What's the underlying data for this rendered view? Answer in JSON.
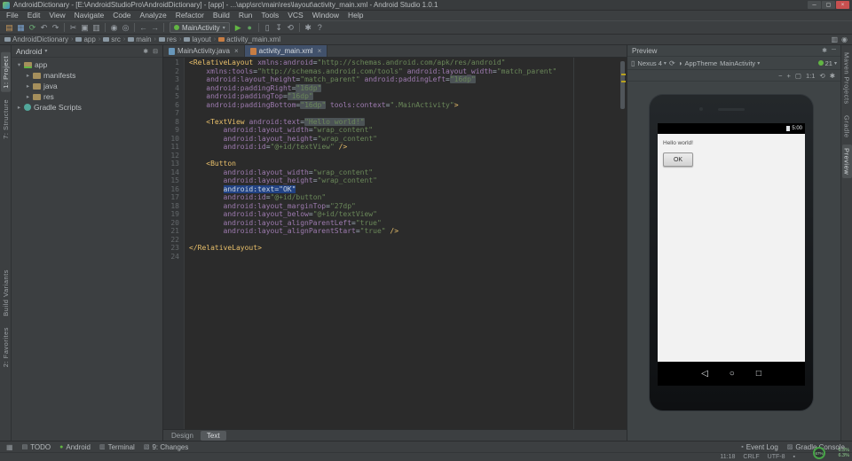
{
  "window": {
    "title": "AndroidDictionary - [E:\\AndroidStudioPro\\AndroidDictionary] - [app] - ...\\app\\src\\main\\res\\layout\\activity_main.xml - Android Studio 1.0.1",
    "controls": {
      "minimize": "─",
      "maximize": "▢",
      "close": "×"
    }
  },
  "menubar": {
    "items": [
      "File",
      "Edit",
      "View",
      "Navigate",
      "Code",
      "Analyze",
      "Refactor",
      "Build",
      "Run",
      "Tools",
      "VCS",
      "Window",
      "Help"
    ]
  },
  "toolbar": {
    "run_config": "MainActivity",
    "items": [
      {
        "name": "open",
        "glyph": "▤",
        "color": "#c9985a"
      },
      {
        "name": "save-all",
        "glyph": "▦",
        "color": "#7ba3d0"
      },
      {
        "name": "sync",
        "glyph": "⟳",
        "color": "#6aab73"
      },
      {
        "name": "undo",
        "glyph": "↶",
        "color": "#9aa0a6"
      },
      {
        "name": "redo",
        "glyph": "↷",
        "color": "#9aa0a6"
      },
      {
        "sep": true
      },
      {
        "name": "cut",
        "glyph": "✂",
        "color": "#9aa0a6"
      },
      {
        "name": "copy",
        "glyph": "▣",
        "color": "#9aa0a6"
      },
      {
        "name": "paste",
        "glyph": "▥",
        "color": "#9aa0a6"
      },
      {
        "sep": true
      },
      {
        "name": "find",
        "glyph": "◉",
        "color": "#9aa0a6"
      },
      {
        "name": "replace",
        "glyph": "◎",
        "color": "#9aa0a6"
      },
      {
        "sep": true
      },
      {
        "name": "back",
        "glyph": "←",
        "color": "#8a9096"
      },
      {
        "name": "forward",
        "glyph": "→",
        "color": "#8a9096"
      },
      {
        "sep": true
      },
      {
        "combo": true
      },
      {
        "name": "run",
        "glyph": "▶",
        "color": "#62b543"
      },
      {
        "name": "debug",
        "glyph": "●",
        "color": "#5f9e5f"
      },
      {
        "sep": true
      },
      {
        "name": "avd-manager",
        "glyph": "▯",
        "color": "#9aa0a6"
      },
      {
        "name": "sdk-manager",
        "glyph": "↧",
        "color": "#9aa0a6"
      },
      {
        "name": "gradle-sync",
        "glyph": "⟲",
        "color": "#9aa0a6"
      },
      {
        "sep": true
      },
      {
        "name": "settings",
        "glyph": "✱",
        "color": "#9aa0a6"
      },
      {
        "name": "help",
        "glyph": "?",
        "color": "#9aa0a6"
      }
    ]
  },
  "breadcrumbs": {
    "items": [
      "AndroidDictionary",
      "app",
      "src",
      "main",
      "res",
      "layout",
      "activity_main.xml"
    ],
    "right_icons": [
      {
        "name": "android-monitor",
        "glyph": "▥"
      },
      {
        "name": "search-everywhere",
        "glyph": "◉"
      }
    ]
  },
  "left_stripe": {
    "items": [
      {
        "label": "1: Project",
        "active": true
      },
      {
        "label": "7: Structure"
      },
      {
        "label": "Build Variants",
        "gap": true
      },
      {
        "label": "2: Favorites"
      }
    ]
  },
  "right_stripe": {
    "items": [
      {
        "label": "Maven Projects"
      },
      {
        "label": "Gradle"
      },
      {
        "label": "Preview",
        "active": true
      }
    ]
  },
  "project": {
    "header": "Android",
    "tree": [
      {
        "label": "app",
        "depth": 0,
        "expanded": true,
        "icon": "folder-app"
      },
      {
        "label": "manifests",
        "depth": 1,
        "expanded": false,
        "icon": "folder"
      },
      {
        "label": "java",
        "depth": 1,
        "expanded": false,
        "icon": "folder"
      },
      {
        "label": "res",
        "depth": 1,
        "expanded": false,
        "icon": "folder"
      },
      {
        "label": "Gradle Scripts",
        "depth": 0,
        "expanded": false,
        "icon": "gradle"
      }
    ]
  },
  "editor": {
    "tabs": [
      {
        "label": "MainActivity.java",
        "active": false
      },
      {
        "label": "activity_main.xml",
        "active": true
      }
    ],
    "bottom_tabs": [
      {
        "label": "Design",
        "active": false
      },
      {
        "label": "Text",
        "active": true
      }
    ],
    "code": [
      [
        [
          "tg",
          "<RelativeLayout"
        ],
        [
          "pl",
          " "
        ],
        [
          "at",
          "xmlns:android"
        ],
        [
          "pl",
          "="
        ],
        [
          "vl",
          "\"http://schemas.android.com/apk/res/android\""
        ]
      ],
      [
        [
          "pl",
          "    "
        ],
        [
          "at",
          "xmlns:tools"
        ],
        [
          "pl",
          "="
        ],
        [
          "vl",
          "\"http://schemas.android.com/tools\""
        ],
        [
          "pl",
          " "
        ],
        [
          "at",
          "android:layout_width"
        ],
        [
          "pl",
          "="
        ],
        [
          "vl",
          "\"match_parent\""
        ]
      ],
      [
        [
          "pl",
          "    "
        ],
        [
          "at",
          "android:layout_height"
        ],
        [
          "pl",
          "="
        ],
        [
          "vl",
          "\"match_parent\""
        ],
        [
          "pl",
          " "
        ],
        [
          "at",
          "android:paddingLeft"
        ],
        [
          "pl",
          "="
        ],
        [
          "vl",
          "\"16dp\"",
          "box"
        ]
      ],
      [
        [
          "pl",
          "    "
        ],
        [
          "at",
          "android:paddingRight"
        ],
        [
          "pl",
          "="
        ],
        [
          "vl",
          "\"16dp\"",
          "box"
        ]
      ],
      [
        [
          "pl",
          "    "
        ],
        [
          "at",
          "android:paddingTop"
        ],
        [
          "pl",
          "="
        ],
        [
          "vl",
          "\"16dp\"",
          "box"
        ]
      ],
      [
        [
          "pl",
          "    "
        ],
        [
          "at",
          "android:paddingBottom"
        ],
        [
          "pl",
          "="
        ],
        [
          "vl",
          "\"16dp\"",
          "box"
        ],
        [
          "pl",
          " "
        ],
        [
          "at",
          "tools:context"
        ],
        [
          "pl",
          "="
        ],
        [
          "vl",
          "\".MainActivity\""
        ],
        [
          "tg",
          ">"
        ]
      ],
      [],
      [
        [
          "pl",
          "    "
        ],
        [
          "tg",
          "<TextView"
        ],
        [
          "pl",
          " "
        ],
        [
          "at",
          "android:text"
        ],
        [
          "pl",
          "="
        ],
        [
          "vl",
          "\"Hello world!\"",
          "box"
        ]
      ],
      [
        [
          "pl",
          "        "
        ],
        [
          "at",
          "android:layout_width"
        ],
        [
          "pl",
          "="
        ],
        [
          "vl",
          "\"wrap_content\""
        ]
      ],
      [
        [
          "pl",
          "        "
        ],
        [
          "at",
          "android:layout_height"
        ],
        [
          "pl",
          "="
        ],
        [
          "vl",
          "\"wrap_content\""
        ]
      ],
      [
        [
          "pl",
          "        "
        ],
        [
          "at",
          "android:id"
        ],
        [
          "pl",
          "="
        ],
        [
          "vl",
          "\"@+id/textView\""
        ],
        [
          "pl",
          " "
        ],
        [
          "tg",
          "/>"
        ]
      ],
      [],
      [
        [
          "pl",
          "    "
        ],
        [
          "tg",
          "<Button"
        ]
      ],
      [
        [
          "pl",
          "        "
        ],
        [
          "at",
          "android:layout_width"
        ],
        [
          "pl",
          "="
        ],
        [
          "vl",
          "\"wrap_content\""
        ]
      ],
      [
        [
          "pl",
          "        "
        ],
        [
          "at",
          "android:layout_height"
        ],
        [
          "pl",
          "="
        ],
        [
          "vl",
          "\"wrap_content\""
        ]
      ],
      [
        [
          "pl",
          "        "
        ],
        [
          "at",
          "android:text",
          "sel"
        ],
        [
          "pl",
          "=",
          "sel"
        ],
        [
          "vl",
          "\"OK\"",
          "sel"
        ]
      ],
      [
        [
          "pl",
          "        "
        ],
        [
          "at",
          "android:id"
        ],
        [
          "pl",
          "="
        ],
        [
          "vl",
          "\"@+id/button\""
        ]
      ],
      [
        [
          "pl",
          "        "
        ],
        [
          "at",
          "android:layout_marginTop"
        ],
        [
          "pl",
          "="
        ],
        [
          "vl",
          "\"27dp\""
        ]
      ],
      [
        [
          "pl",
          "        "
        ],
        [
          "at",
          "android:layout_below"
        ],
        [
          "pl",
          "="
        ],
        [
          "vl",
          "\"@+id/textView\""
        ]
      ],
      [
        [
          "pl",
          "        "
        ],
        [
          "at",
          "android:layout_alignParentLeft"
        ],
        [
          "pl",
          "="
        ],
        [
          "vl",
          "\"true\""
        ]
      ],
      [
        [
          "pl",
          "        "
        ],
        [
          "at",
          "android:layout_alignParentStart"
        ],
        [
          "pl",
          "="
        ],
        [
          "vl",
          "\"true\""
        ],
        [
          "pl",
          " "
        ],
        [
          "tg",
          "/>"
        ]
      ],
      [],
      [
        [
          "tg",
          "</RelativeLayout>"
        ]
      ],
      []
    ]
  },
  "preview": {
    "title": "Preview",
    "header_icons": [
      {
        "name": "gear",
        "glyph": "✱"
      },
      {
        "name": "hide",
        "glyph": "─"
      }
    ],
    "config": {
      "device": "Nexus 4",
      "theme": "AppTheme",
      "activity": "MainActivity",
      "api_level": "21"
    },
    "zoom_icons": [
      {
        "name": "zoom-out",
        "glyph": "−"
      },
      {
        "name": "zoom-in",
        "glyph": "+"
      },
      {
        "name": "zoom-fit",
        "glyph": "▢"
      },
      {
        "name": "zoom-actual",
        "glyph": "1:1"
      },
      {
        "name": "refresh",
        "glyph": "⟲"
      },
      {
        "name": "render-settings",
        "glyph": "✱"
      }
    ],
    "phone": {
      "status_time": "5:00",
      "content_text": "Hello world!",
      "button_label": "OK",
      "nav_icons": [
        {
          "name": "back",
          "glyph": "◁"
        },
        {
          "name": "home",
          "glyph": "○"
        },
        {
          "name": "recents",
          "glyph": "□"
        }
      ]
    }
  },
  "bottom": {
    "left_tabs": [
      {
        "label": "TODO",
        "glyph": "▤"
      },
      {
        "label": "Android",
        "glyph": "●",
        "color": "#62b543"
      },
      {
        "label": "Terminal",
        "glyph": "▥"
      },
      {
        "label": "9: Changes",
        "glyph": "▧"
      }
    ],
    "right_tabs": [
      {
        "label": "Event Log",
        "glyph": "▪"
      },
      {
        "label": "Gradle Console",
        "glyph": "▨"
      }
    ],
    "status_info": [
      "11:18",
      "CRLF",
      "UTF-8"
    ],
    "gauge": "67%",
    "meters": [
      "6.3%",
      "6.3%"
    ]
  },
  "colors": {
    "editor_bg": "#2b2b2b",
    "panel_bg": "#3c3f41",
    "tag": "#e8bf6a",
    "attribute": "#9e7bb0",
    "value": "#6a8759",
    "selection": "#214283",
    "accent_green": "#62b543"
  }
}
